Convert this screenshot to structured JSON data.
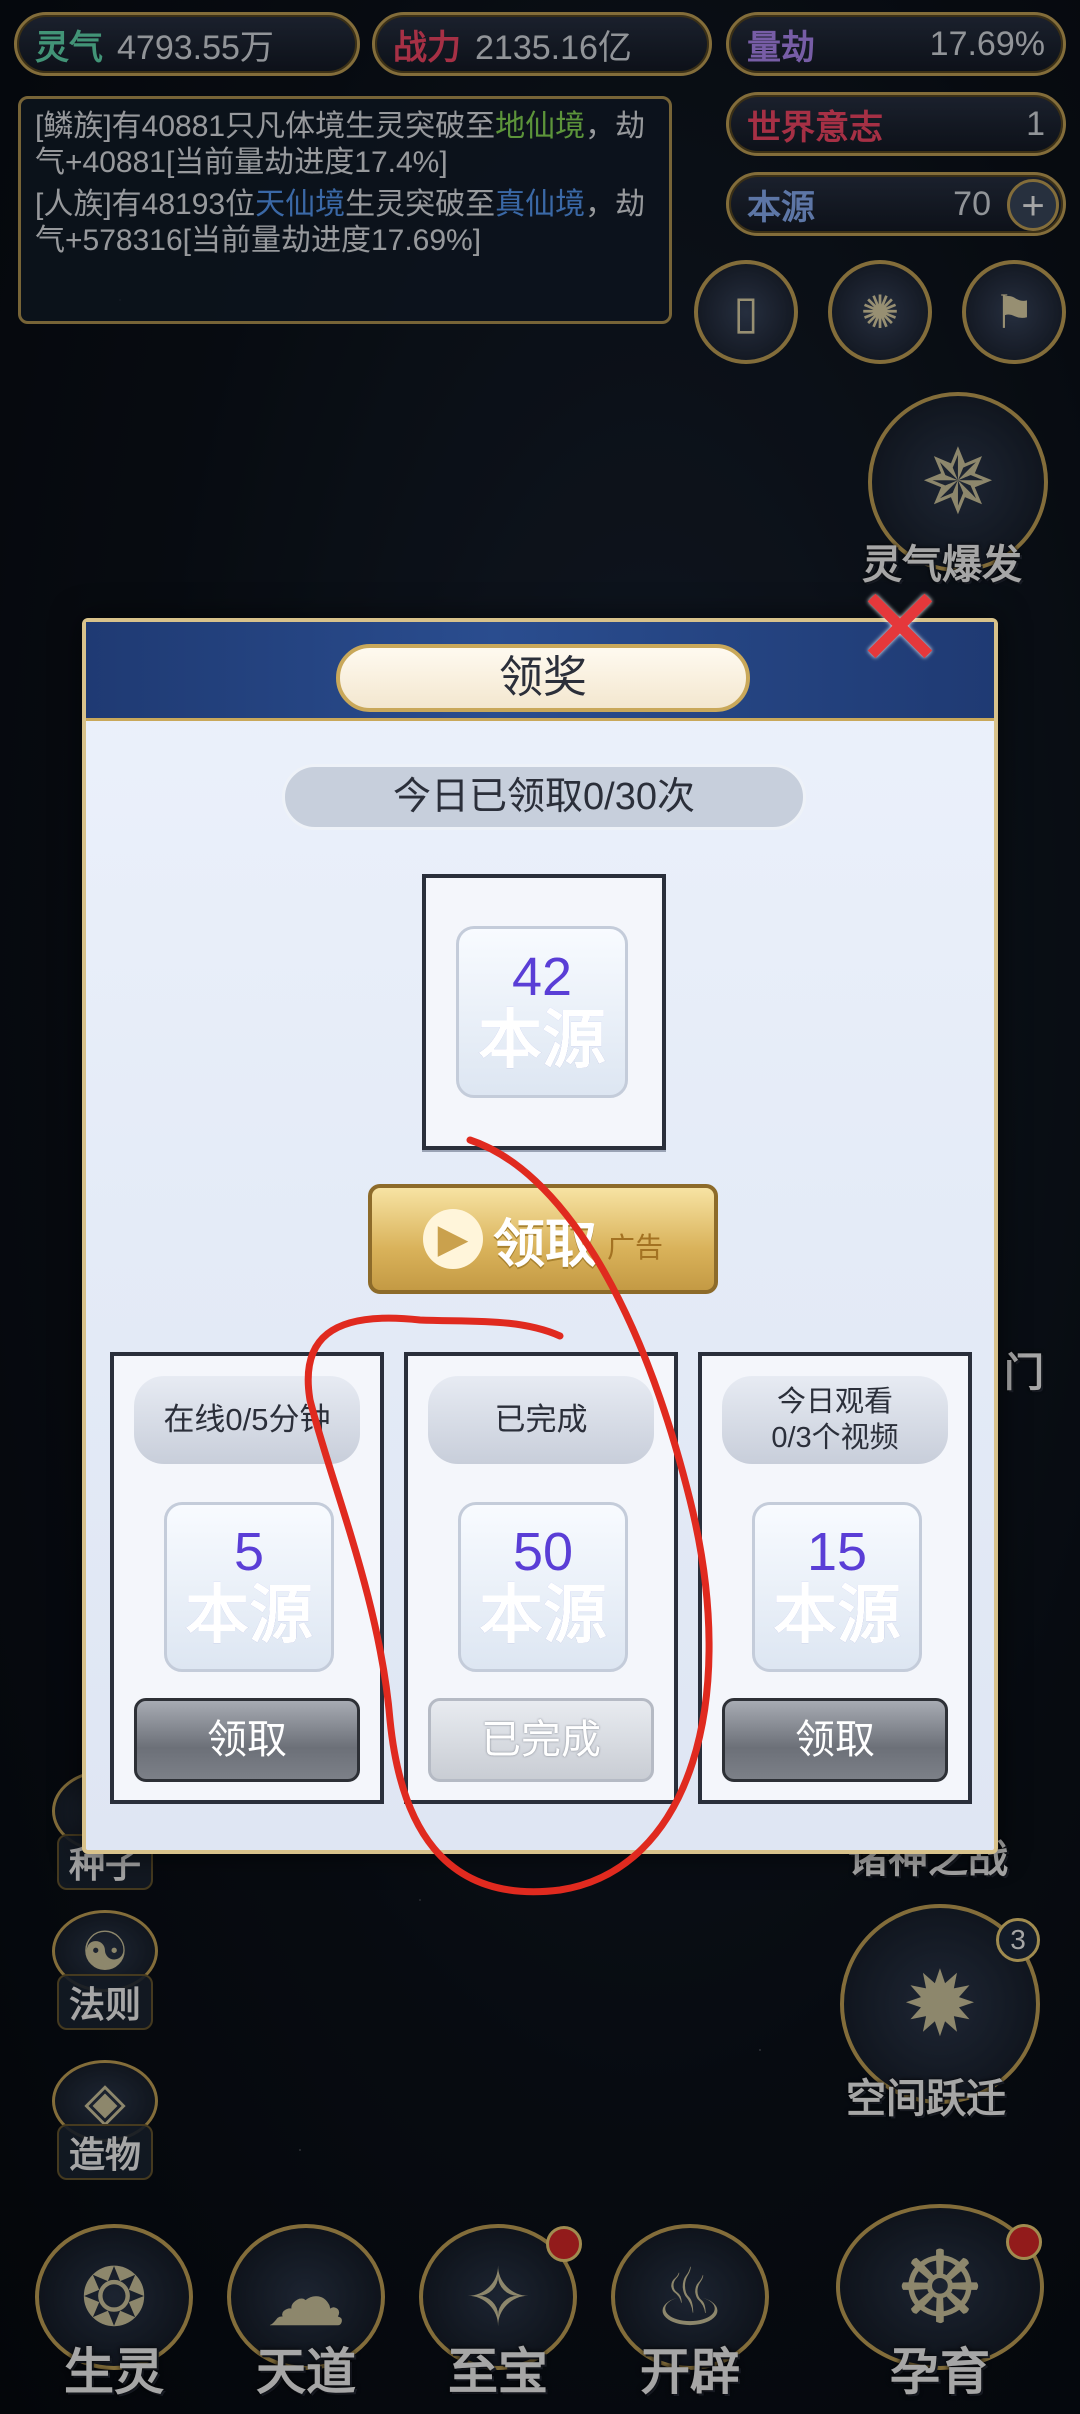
{
  "stats": {
    "lingqi_label": "灵气",
    "lingqi_value": "4793.55万",
    "zhanli_label": "战力",
    "zhanli_value": "2135.16亿",
    "liangjie_label": "量劫",
    "liangjie_value": "17.69%",
    "shijie_label": "世界意志",
    "shijie_value": "1",
    "benyuan_label": "本源",
    "benyuan_value": "70",
    "plus_icon": "plus-icon"
  },
  "log": {
    "entry1_a": "[鳞族]有40881只凡体境生灵突破至",
    "entry1_hl": "地仙境",
    "entry1_b": "，劫气+40881[当前量劫进度17.4%]",
    "entry2_a": "[人族]有48193位",
    "entry2_hl1": "天仙境",
    "entry2_b": "生灵突破至",
    "entry2_hl2": "真仙境",
    "entry2_c": "，劫气+578316[当前量劫进度17.69%]"
  },
  "side_right": {
    "burst_label": "灵气爆发",
    "jump_label": "空间跃迁",
    "jump_badge": "3",
    "war_label": "诸神之战",
    "gate_label": "门"
  },
  "side_left": [
    {
      "label": "种子"
    },
    {
      "label": "法则"
    },
    {
      "label": "造物"
    }
  ],
  "bottom_nav": [
    {
      "label": "生灵"
    },
    {
      "label": "天道"
    },
    {
      "label": "至宝"
    },
    {
      "label": "开辟"
    },
    {
      "label": "孕育"
    }
  ],
  "modal": {
    "title": "领奖",
    "count_text": "今日已领取0/30次",
    "main_reward": {
      "amount": "42",
      "name": "本源"
    },
    "claim_ad_label": "领取",
    "claim_ad_tag": "广告",
    "tasks": [
      {
        "status": "在线0/5分钟",
        "amount": "5",
        "name": "本源",
        "button": "领取"
      },
      {
        "status": "已完成",
        "amount": "50",
        "name": "本源",
        "button": "已完成"
      },
      {
        "status": "今日观看\n0/3个视频",
        "amount": "15",
        "name": "本源",
        "button": "领取"
      }
    ]
  },
  "colors": {
    "accent_gold": "#c9a85a",
    "annotation_red": "#e02a1f"
  }
}
